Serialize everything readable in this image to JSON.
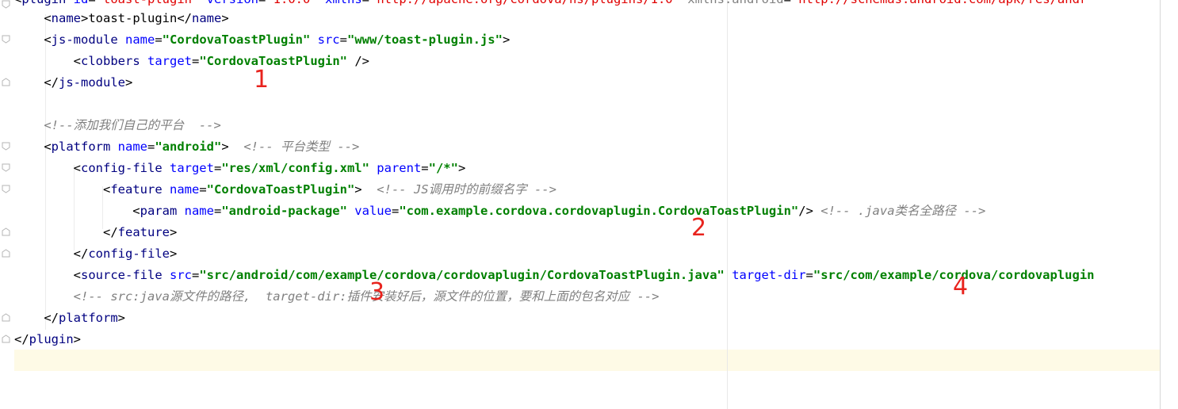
{
  "editor": {
    "lines": [
      {
        "id": "l1",
        "segs": [
          [
            "tag",
            "<"
          ],
          [
            "tag-b",
            "plugin "
          ],
          [
            "attr",
            "id"
          ],
          [
            "tag",
            "="
          ],
          [
            "val-red",
            "\"toast-plugin\" "
          ],
          [
            "attr",
            "version"
          ],
          [
            "tag",
            "="
          ],
          [
            "val-red",
            "\"1.0.0\" "
          ],
          [
            "attr",
            "xmlns"
          ],
          [
            "tag",
            "="
          ],
          [
            "val-red",
            "\"http://apache.org/cordova/ns/plugins/1.0\" "
          ],
          [
            "dim",
            "xmlns:android"
          ],
          [
            "tag",
            "="
          ],
          [
            "val-red",
            "\"http://schemas.android.com/apk/res/andr"
          ]
        ]
      },
      {
        "id": "l2",
        "segs": [
          [
            "tag",
            "    <"
          ],
          [
            "tag-b",
            "name"
          ],
          [
            "tag",
            ">"
          ],
          [
            "text",
            "toast-plugin"
          ],
          [
            "tag",
            "</"
          ],
          [
            "tag-b",
            "name"
          ],
          [
            "tag",
            ">"
          ]
        ]
      },
      {
        "id": "l3",
        "segs": [
          [
            "tag",
            "    <"
          ],
          [
            "tag-b",
            "js-module "
          ],
          [
            "attr",
            "name"
          ],
          [
            "tag",
            "="
          ],
          [
            "val",
            "\"CordovaToastPlugin\" "
          ],
          [
            "attr",
            "src"
          ],
          [
            "tag",
            "="
          ],
          [
            "val",
            "\"www/toast-plugin.js\""
          ],
          [
            "tag",
            ">"
          ]
        ]
      },
      {
        "id": "l4",
        "segs": [
          [
            "tag",
            "        <"
          ],
          [
            "tag-b",
            "clobbers "
          ],
          [
            "attr",
            "target"
          ],
          [
            "tag",
            "="
          ],
          [
            "val",
            "\"CordovaToastPlugin\" "
          ],
          [
            "tag",
            "/>"
          ]
        ]
      },
      {
        "id": "l5",
        "segs": [
          [
            "tag",
            "    </"
          ],
          [
            "tag-b",
            "js-module"
          ],
          [
            "tag",
            ">"
          ]
        ]
      },
      {
        "id": "l6",
        "segs": []
      },
      {
        "id": "l7",
        "segs": [
          [
            "cm",
            "    <!--添加我们自己的平台  -->"
          ]
        ]
      },
      {
        "id": "l8",
        "segs": [
          [
            "tag",
            "    <"
          ],
          [
            "tag-b",
            "platform "
          ],
          [
            "attr",
            "name"
          ],
          [
            "tag",
            "="
          ],
          [
            "val",
            "\"android\""
          ],
          [
            "tag",
            ">  "
          ],
          [
            "cm",
            "<!-- 平台类型 -->"
          ]
        ]
      },
      {
        "id": "l9",
        "segs": [
          [
            "tag",
            "        <"
          ],
          [
            "tag-b",
            "config-file "
          ],
          [
            "attr",
            "target"
          ],
          [
            "tag",
            "="
          ],
          [
            "val",
            "\"res/xml/config.xml\" "
          ],
          [
            "attr",
            "parent"
          ],
          [
            "tag",
            "="
          ],
          [
            "val",
            "\"/*\""
          ],
          [
            "tag",
            ">"
          ]
        ]
      },
      {
        "id": "l10",
        "segs": [
          [
            "tag",
            "            <"
          ],
          [
            "tag-b",
            "feature "
          ],
          [
            "attr",
            "name"
          ],
          [
            "tag",
            "="
          ],
          [
            "val",
            "\"CordovaToastPlugin\""
          ],
          [
            "tag",
            ">  "
          ],
          [
            "cm",
            "<!-- JS调用时的前缀名字 -->"
          ]
        ]
      },
      {
        "id": "l11",
        "segs": [
          [
            "tag",
            "                <"
          ],
          [
            "tag-b",
            "param "
          ],
          [
            "attr",
            "name"
          ],
          [
            "tag",
            "="
          ],
          [
            "val",
            "\"android-package\" "
          ],
          [
            "attr",
            "value"
          ],
          [
            "tag",
            "="
          ],
          [
            "val",
            "\"com.example.cordova.cordovaplugin.CordovaToastPlugin\""
          ],
          [
            "tag",
            "/> "
          ],
          [
            "cm",
            "<!-- .java类名全路径 -->"
          ]
        ]
      },
      {
        "id": "l12",
        "segs": [
          [
            "tag",
            "            </"
          ],
          [
            "tag-b",
            "feature"
          ],
          [
            "tag",
            ">"
          ]
        ]
      },
      {
        "id": "l13",
        "segs": [
          [
            "tag",
            "        </"
          ],
          [
            "tag-b",
            "config-file"
          ],
          [
            "tag",
            ">"
          ]
        ]
      },
      {
        "id": "l14",
        "segs": [
          [
            "tag",
            "        <"
          ],
          [
            "tag-b",
            "source-file "
          ],
          [
            "attr",
            "src"
          ],
          [
            "tag",
            "="
          ],
          [
            "val",
            "\"src/android/com/example/cordova/cordovaplugin/CordovaToastPlugin.java\" "
          ],
          [
            "attr",
            "target-dir"
          ],
          [
            "tag",
            "="
          ],
          [
            "val",
            "\"src/com/example/cordova/cordovaplugin"
          ]
        ]
      },
      {
        "id": "l15",
        "segs": [
          [
            "cm",
            "        <!-- src:java源文件的路径,  target-dir:插件安装好后，源文件的位置，要和上面的包名对应 -->"
          ]
        ]
      },
      {
        "id": "l16",
        "segs": [
          [
            "tag",
            "    </"
          ],
          [
            "tag-b",
            "platform"
          ],
          [
            "tag",
            ">"
          ]
        ]
      },
      {
        "id": "l17",
        "segs": [
          [
            "tag",
            "</"
          ],
          [
            "tag-b",
            "plugin"
          ],
          [
            "tag",
            ">"
          ]
        ]
      }
    ]
  },
  "annotations": [
    "1",
    "2",
    "3",
    "4"
  ],
  "colors": {
    "tag_name": "#000080",
    "attribute": "#0000ff",
    "value": "#008000",
    "comment": "#808080",
    "marker": "#e8231d",
    "caret_line": "#fefae6"
  }
}
